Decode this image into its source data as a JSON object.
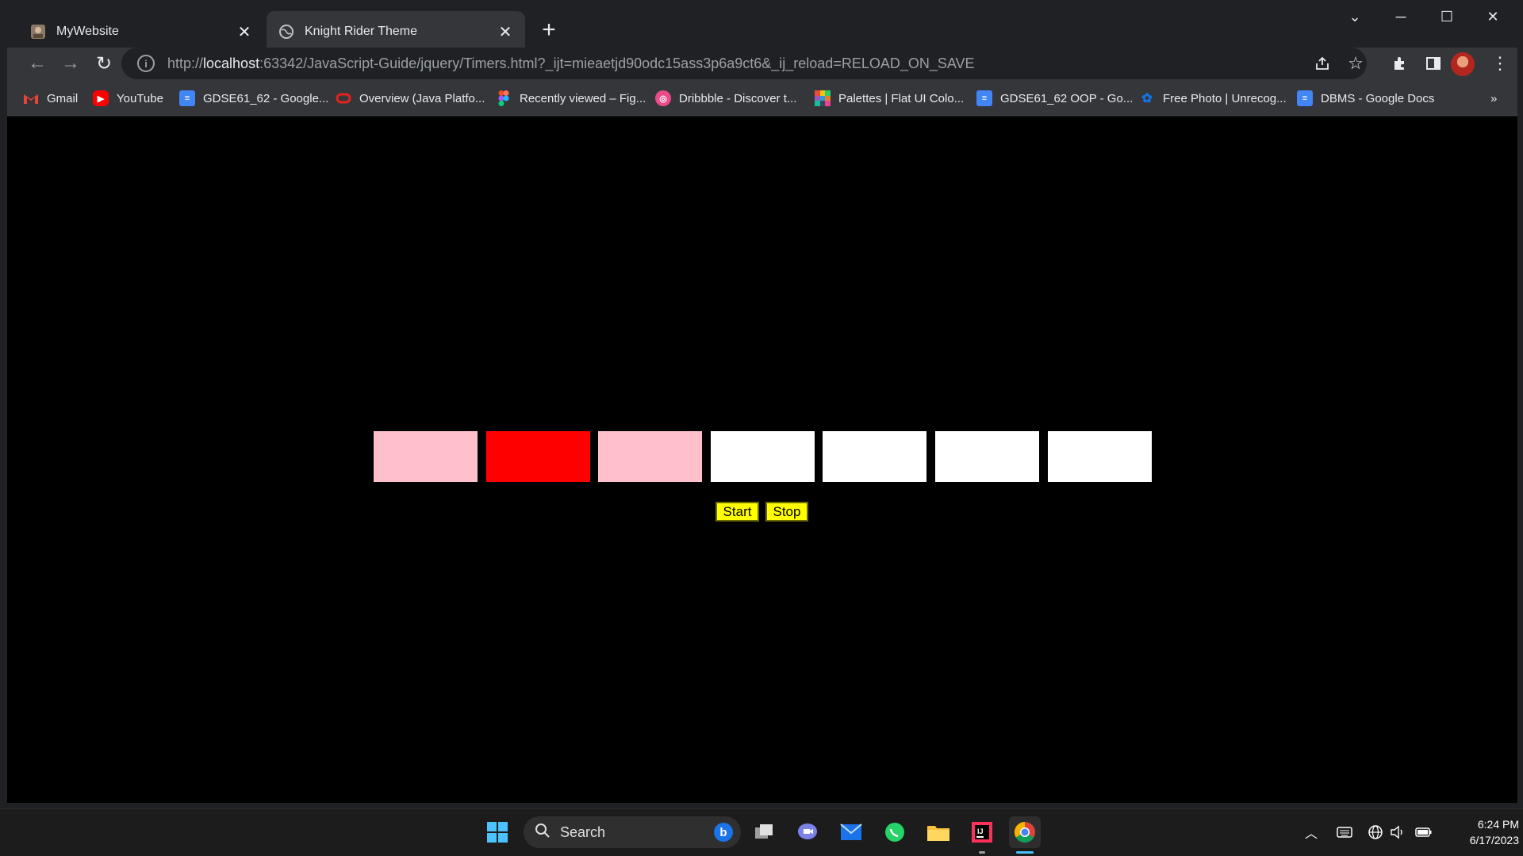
{
  "tabs": [
    {
      "title": "MyWebsite",
      "active": false
    },
    {
      "title": "Knight Rider Theme",
      "active": true
    }
  ],
  "address": {
    "scheme": "http://",
    "host": "localhost",
    "rest": ":63342/JavaScript-Guide/jquery/Timers.html?_ijt=mieaetjd90odc15ass3p6a9ct6&_ij_reload=RELOAD_ON_SAVE"
  },
  "bookmarks": [
    {
      "label": "Gmail",
      "icon": "gmail-icon",
      "color": "#ea4335"
    },
    {
      "label": "YouTube",
      "icon": "youtube-icon",
      "color": "#ff0000"
    },
    {
      "label": "GDSE61_62 - Google...",
      "icon": "google-docs-icon",
      "color": "#4285f4"
    },
    {
      "label": "Overview (Java Platfo...",
      "icon": "oracle-icon",
      "color": "#e2231a"
    },
    {
      "label": "Recently viewed – Fig...",
      "icon": "figma-icon",
      "color": "#a259ff"
    },
    {
      "label": "Dribbble - Discover t...",
      "icon": "dribbble-icon",
      "color": "#ea4c89"
    },
    {
      "label": "Palettes | Flat UI Colo...",
      "icon": "palette-icon",
      "color": "#f1c40f"
    },
    {
      "label": "GDSE61_62 OOP - Go...",
      "icon": "google-docs-icon",
      "color": "#4285f4"
    },
    {
      "label": "Free Photo | Unrecog...",
      "icon": "freepik-icon",
      "color": "#1273eb"
    },
    {
      "label": "DBMS - Google Docs",
      "icon": "google-docs-icon",
      "color": "#4285f4"
    }
  ],
  "lights": [
    {
      "name": "light-1",
      "color": "#ffc0cb"
    },
    {
      "name": "light-2",
      "color": "#ff0000"
    },
    {
      "name": "light-3",
      "color": "#ffc0cb"
    },
    {
      "name": "light-4",
      "color": "#ffffff"
    },
    {
      "name": "light-5",
      "color": "#ffffff"
    },
    {
      "name": "light-6",
      "color": "#ffffff"
    },
    {
      "name": "light-7",
      "color": "#ffffff"
    }
  ],
  "controls": {
    "start_label": "Start",
    "stop_label": "Stop",
    "button_color": "#ffff00"
  },
  "taskbar": {
    "search_label": "Search",
    "time": "6:24 PM",
    "date": "6/17/2023"
  }
}
